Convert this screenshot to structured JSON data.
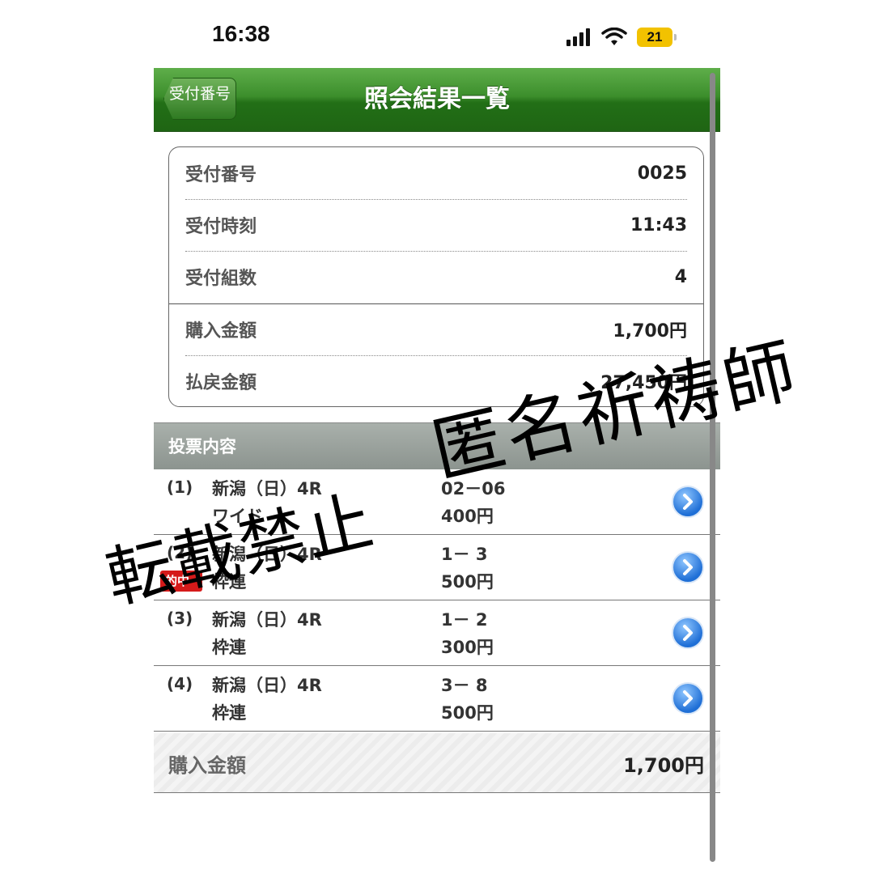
{
  "status_bar": {
    "time": "16:38",
    "battery": "21",
    "icons": [
      "signal-icon",
      "wifi-icon",
      "battery-icon"
    ]
  },
  "navbar": {
    "back_label": "受付番号",
    "title": "照会結果一覧"
  },
  "info": {
    "rows": [
      {
        "label": "受付番号",
        "value": "0025"
      },
      {
        "label": "受付時刻",
        "value": "11:43"
      },
      {
        "label": "受付組数",
        "value": "4"
      },
      {
        "label": "購入金額",
        "value": "1,700円"
      },
      {
        "label": "払戻金額",
        "value": "27,450円"
      }
    ]
  },
  "section": {
    "title": "投票内容"
  },
  "tickets": [
    {
      "num": "(1)",
      "race": "新潟（日）4R",
      "type": "ワイド",
      "combo": "02－06",
      "amount": "400円",
      "hit": ""
    },
    {
      "num": "(2)",
      "race": "新潟（日）4R",
      "type": "枠連",
      "combo": "1－ 3",
      "amount": "500円",
      "hit": "的中"
    },
    {
      "num": "(3)",
      "race": "新潟（日）4R",
      "type": "枠連",
      "combo": "1－ 2",
      "amount": "300円",
      "hit": ""
    },
    {
      "num": "(4)",
      "race": "新潟（日）4R",
      "type": "枠連",
      "combo": "3－ 8",
      "amount": "500円",
      "hit": ""
    }
  ],
  "total": {
    "label": "購入金額",
    "value": "1,700円"
  },
  "watermarks": {
    "left": "転載禁止",
    "right": "匿名祈祷師"
  },
  "colors": {
    "navbar_green": "#2f7a22",
    "section_gray": "#9aa19c",
    "hit_red": "#d51a1a",
    "chevron_blue": "#1f6fd6"
  }
}
